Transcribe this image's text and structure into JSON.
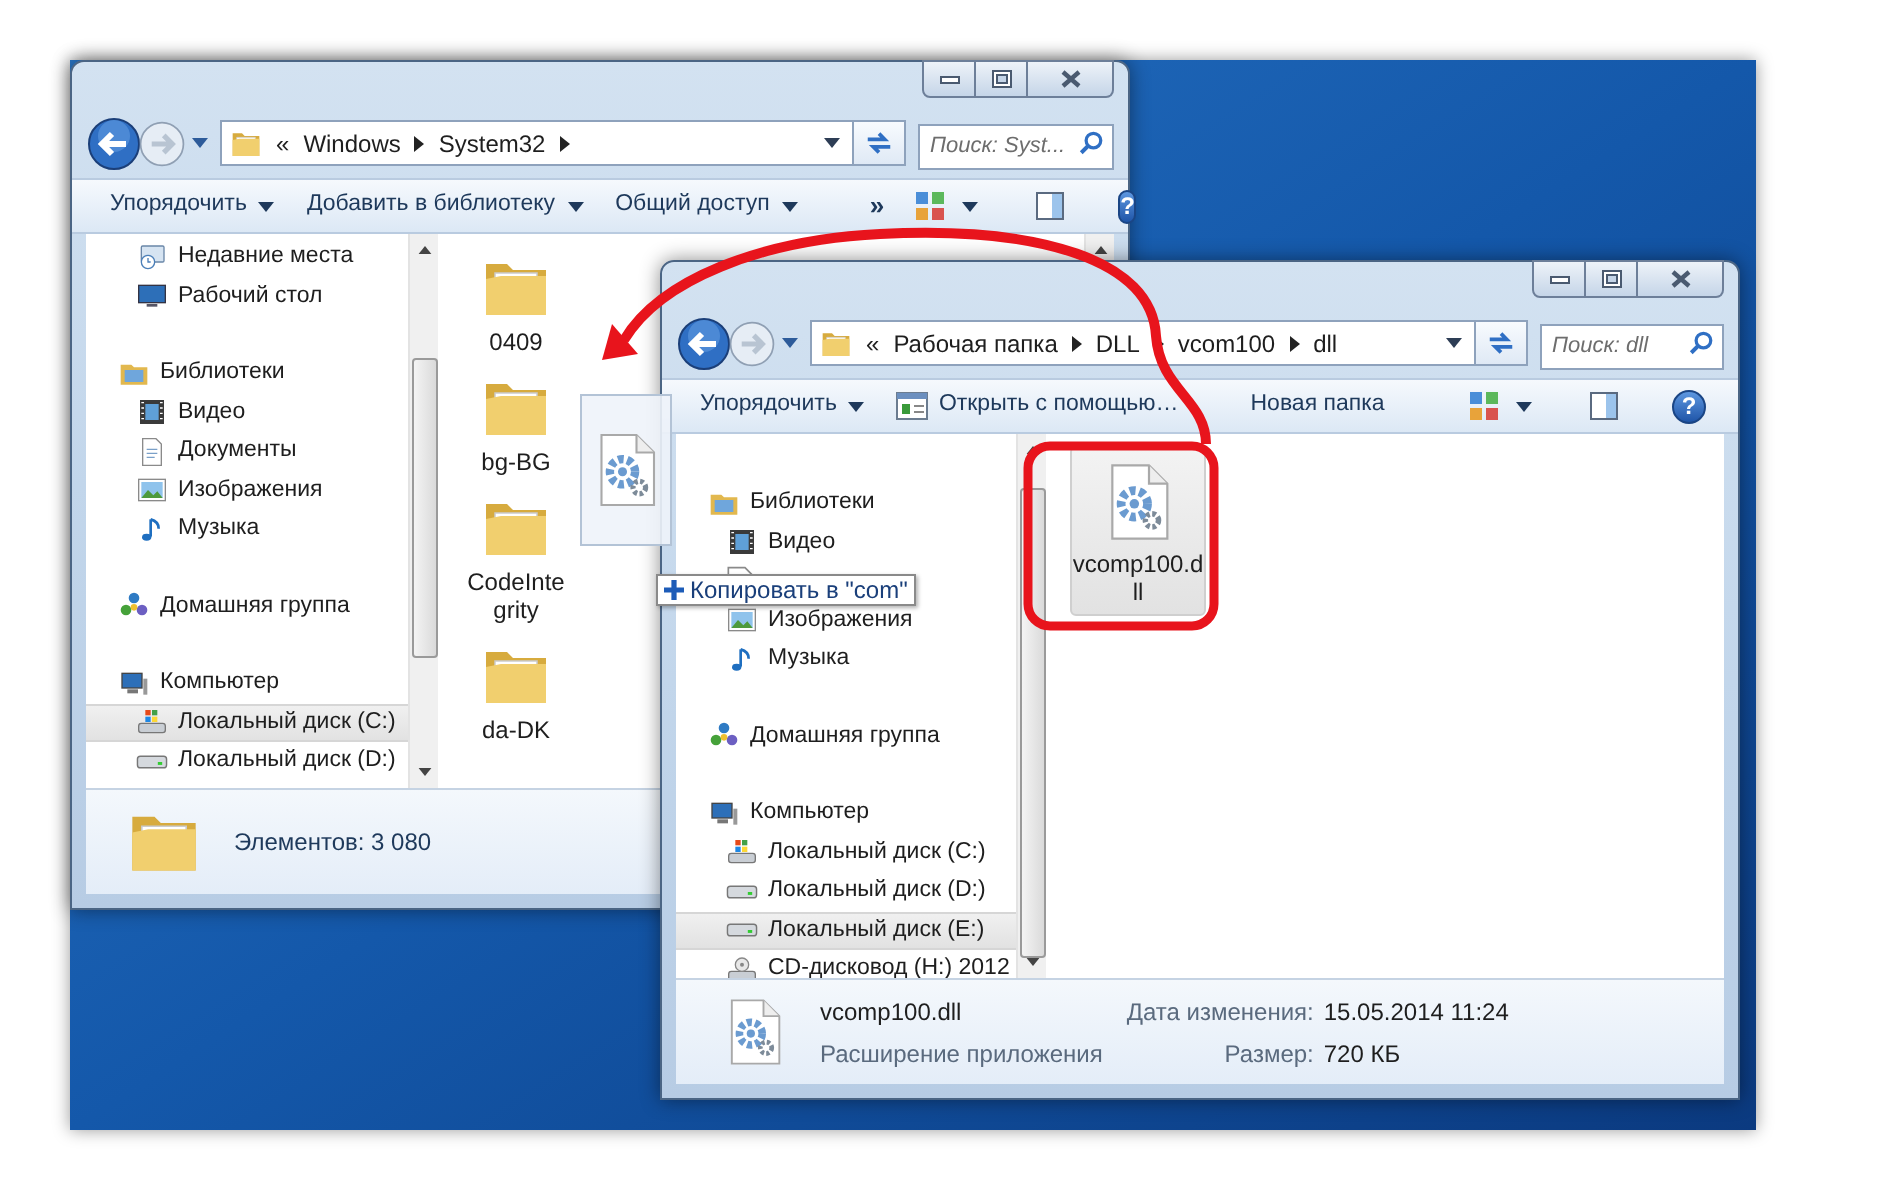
{
  "windows": [
    {
      "kind": "back",
      "address": {
        "overflow": "«",
        "segments": [
          "Windows",
          "System32"
        ],
        "trailing_arrow": true
      },
      "search": {
        "placeholder": "Поиск: Syst..."
      },
      "toolbar": [
        {
          "kind": "menu",
          "label": "Упорядочить"
        },
        {
          "kind": "menu",
          "label": "Добавить в библиотеку"
        },
        {
          "kind": "menu",
          "label": "Общий доступ"
        },
        {
          "kind": "overflow",
          "label": "»"
        }
      ],
      "help": "?",
      "nav": [
        {
          "children": [
            {
              "label": "Недавние места",
              "kind": "recent",
              "selected": false
            },
            {
              "label": "Рабочий стол",
              "kind": "desktop",
              "selected": false
            }
          ]
        },
        {
          "label": "Библиотеки",
          "kind": "library",
          "selected": false,
          "children": [
            {
              "label": "Видео",
              "kind": "video",
              "selected": false
            },
            {
              "label": "Документы",
              "kind": "docs",
              "selected": false
            },
            {
              "label": "Изображения",
              "kind": "images",
              "selected": false
            },
            {
              "label": "Музыка",
              "kind": "music",
              "selected": false
            }
          ]
        },
        {
          "label": "Домашняя группа",
          "kind": "homegroup",
          "selected": false
        },
        {
          "label": "Компьютер",
          "kind": "computer",
          "selected": false,
          "children": [
            {
              "label": "Локальный диск (C:)",
              "kind": "sysdrive",
              "selected": true
            },
            {
              "label": "Локальный диск (D:)",
              "kind": "drive",
              "selected": false
            }
          ]
        }
      ],
      "items": [
        {
          "name": "0409",
          "kind": "folder",
          "selected": false
        },
        {
          "name": "bg-BG",
          "kind": "folder",
          "selected": false
        },
        {
          "name": "CodeIntegrity",
          "kind": "folder",
          "selected": false
        },
        {
          "name": "da-DK",
          "kind": "folder",
          "selected": false
        }
      ],
      "footer": {
        "kind": "status",
        "text": "Элементов: 3 080"
      }
    },
    {
      "kind": "front",
      "address": {
        "overflow": "«",
        "segments": [
          "Рабочая папка",
          "DLL",
          "vcom100",
          "dll"
        ],
        "trailing_arrow": false
      },
      "search": {
        "placeholder": "Поиск: dll"
      },
      "toolbar": [
        {
          "kind": "menu",
          "label": "Упорядочить"
        },
        {
          "kind": "open_with",
          "label": "Открыть с помощью…"
        },
        {
          "kind": "plain",
          "label": "Новая папка"
        }
      ],
      "help": "?",
      "nav": [
        {
          "label": "Библиотеки",
          "kind": "library",
          "selected": false,
          "children": [
            {
              "label": "Видео",
              "kind": "video",
              "selected": false
            },
            {
              "kind": "docs_covered",
              "selected": false
            },
            {
              "label": "Изображения",
              "kind": "images",
              "selected": false
            },
            {
              "label": "Музыка",
              "kind": "music",
              "selected": false
            }
          ]
        },
        {
          "label": "Домашняя группа",
          "kind": "homegroup",
          "selected": false
        },
        {
          "label": "Компьютер",
          "kind": "computer",
          "selected": false,
          "children": [
            {
              "label": "Локальный диск (C:)",
              "kind": "sysdrive",
              "selected": false
            },
            {
              "label": "Локальный диск (D:)",
              "kind": "drive",
              "selected": false
            },
            {
              "label": "Локальный диск (E:)",
              "kind": "drive",
              "selected": true
            },
            {
              "label": "CD-дисковод (H:) 2012",
              "kind": "cdrom",
              "selected": false
            }
          ]
        }
      ],
      "items": [
        {
          "name": "vcomp100.dll",
          "kind": "dll",
          "selected": true
        }
      ],
      "footer": {
        "kind": "details",
        "name": "vcomp100.dll",
        "type": "Расширение приложения",
        "fields": [
          {
            "label": "Дата изменения:",
            "value": "15.05.2014 11:24"
          },
          {
            "label": "Размер:",
            "value": "720 КБ"
          }
        ]
      }
    }
  ],
  "drag": {
    "tooltip": {
      "text": "Копировать в \"com\""
    }
  }
}
